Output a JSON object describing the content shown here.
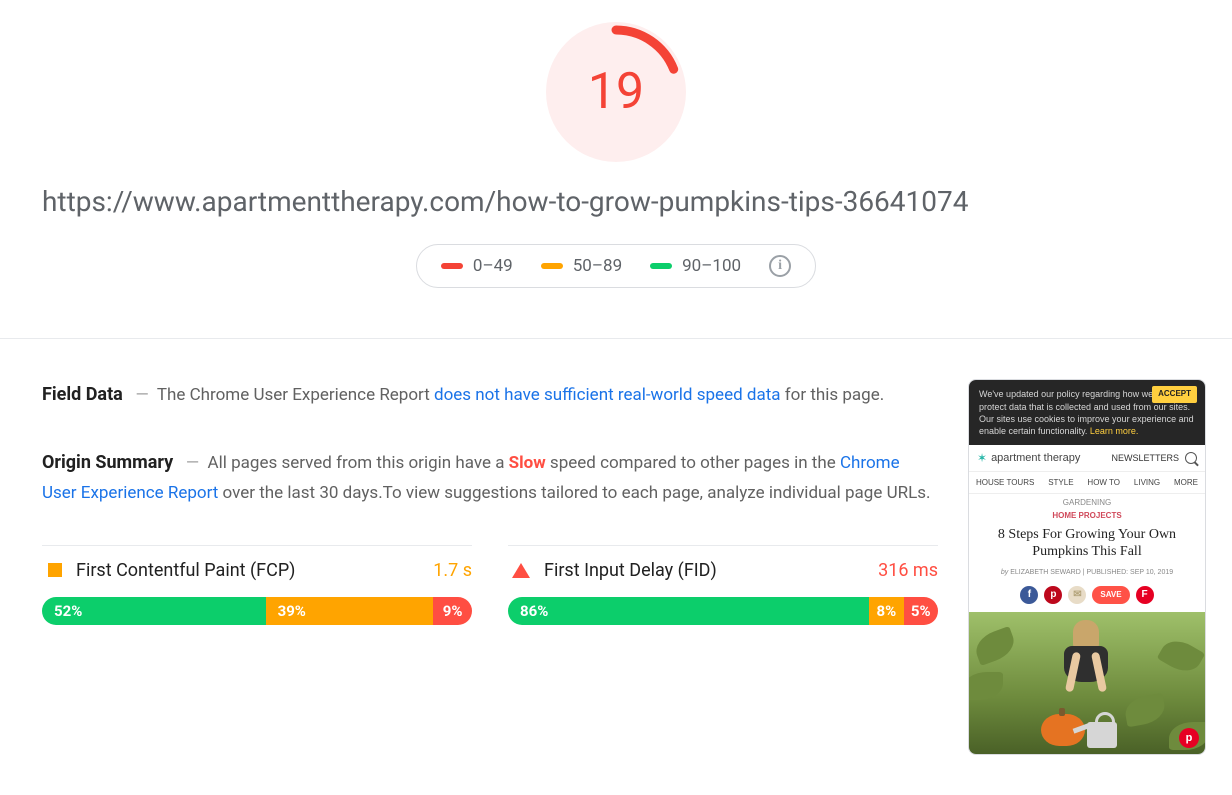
{
  "score": {
    "value": "19",
    "percent": 19
  },
  "url": "https://www.apartmenttherapy.com/how-to-grow-pumpkins-tips-36641074",
  "legend": {
    "range_low": "0–49",
    "range_mid": "50–89",
    "range_high": "90–100"
  },
  "colors": {
    "fail": "#f44336",
    "average": "#ffa400",
    "pass": "#0cce6b",
    "link": "#1a73e8"
  },
  "fieldData": {
    "heading": "Field Data",
    "prefix": "The Chrome User Experience Report ",
    "link": "does not have sufficient real-world speed data",
    "suffix": " for this page."
  },
  "originSummary": {
    "heading": "Origin Summary",
    "text_a": "All pages served from this origin have a ",
    "speed_label": "Slow",
    "text_b": " speed compared to other pages in the ",
    "link": "Chrome User Experience Report",
    "text_c": " over the last 30 days.To view suggestions tailored to each page, analyze individual page URLs."
  },
  "metrics": {
    "fcp": {
      "label": "First Contentful Paint (FCP)",
      "value": "1.7 s",
      "status": "average",
      "dist": {
        "good": 52,
        "avg": 39,
        "poor": 9
      },
      "dist_labels": {
        "good": "52%",
        "avg": "39%",
        "poor": "9%"
      }
    },
    "fid": {
      "label": "First Input Delay (FID)",
      "value": "316 ms",
      "status": "poor",
      "dist": {
        "good": 86,
        "avg": 8,
        "poor": 5
      },
      "dist_labels": {
        "good": "86%",
        "avg": "8%",
        "poor": "5%"
      }
    }
  },
  "preview": {
    "cookie_text": "We've updated our policy regarding how we treat and protect data that is collected and used from our sites. Our sites use cookies to improve your experience and enable certain functionality. ",
    "learn_more": "Learn more.",
    "accept": "ACCEPT",
    "brand": "apartment therapy",
    "newsletters": "NEWSLETTERS",
    "nav": [
      "HOUSE TOURS",
      "STYLE",
      "HOW TO",
      "LIVING",
      "MORE"
    ],
    "sub": "GARDENING",
    "category": "HOME PROJECTS",
    "title": "8 Steps For Growing Your Own Pumpkins This Fall",
    "byline_prefix": "by ",
    "author": "ELIZABETH SEWARD",
    "meta_sep": "  |  ",
    "published_prefix": "PUBLISHED: ",
    "published": "SEP 10, 2019",
    "save": "SAVE",
    "icons": {
      "facebook": "f",
      "pinterest": "p",
      "mail": "✉",
      "flipboard": "F"
    }
  }
}
